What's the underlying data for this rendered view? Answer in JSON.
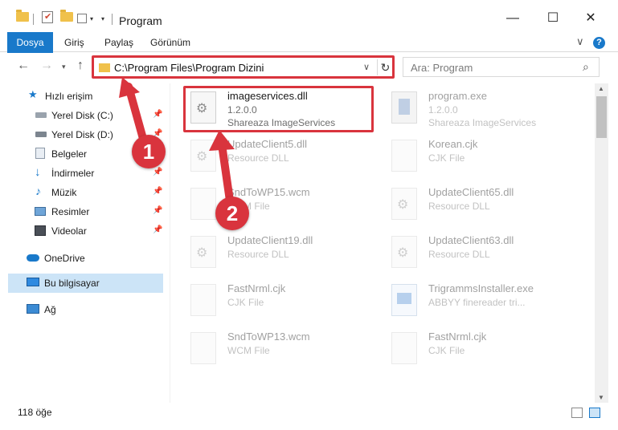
{
  "window": {
    "title": "Program",
    "minimize": "—",
    "maximize": "☐",
    "close": "✕"
  },
  "ribbon": {
    "tabs": [
      "Dosya",
      "Giriş",
      "Paylaş",
      "Görünüm"
    ]
  },
  "address": {
    "path": "C:\\Program Files\\Program Dizini",
    "search_placeholder": "Ara: Program"
  },
  "sidebar": {
    "items": [
      {
        "label": "Hızlı erişim",
        "icon": "star-icon"
      },
      {
        "label": "Yerel Disk (C:)",
        "icon": "drive-icon",
        "pinned": true
      },
      {
        "label": "Yerel Disk (D:)",
        "icon": "drive-icon",
        "pinned": true
      },
      {
        "label": "Belgeler",
        "icon": "documents-icon",
        "pinned": true
      },
      {
        "label": "İndirmeler",
        "icon": "download-icon",
        "pinned": true
      },
      {
        "label": "Müzik",
        "icon": "music-icon",
        "pinned": true
      },
      {
        "label": "Resimler",
        "icon": "pictures-icon",
        "pinned": true
      },
      {
        "label": "Videolar",
        "icon": "video-icon",
        "pinned": true
      },
      {
        "label": "OneDrive",
        "icon": "cloud-icon"
      },
      {
        "label": "Bu bilgisayar",
        "icon": "computer-icon",
        "selected": true
      },
      {
        "label": "Ağ",
        "icon": "network-icon"
      }
    ]
  },
  "files": [
    {
      "name": "imageservices.dll",
      "line2": "1.2.0.0",
      "line3": "Shareaza ImageServices",
      "type": "dll"
    },
    {
      "name": "program.exe",
      "line2": "1.2.0.0",
      "line3": "Shareaza ImageServices",
      "type": "prog"
    },
    {
      "name": "UpdateClient5.dll",
      "line2": "Resource DLL",
      "line3": "",
      "type": "dll"
    },
    {
      "name": "Korean.cjk",
      "line2": "CJK File",
      "line3": "",
      "type": "doc"
    },
    {
      "name": "SndToWP15.wcm",
      "line2": "WCM File",
      "line3": "",
      "type": "doc"
    },
    {
      "name": "UpdateClient65.dll",
      "line2": "Resource DLL",
      "line3": "",
      "type": "dll"
    },
    {
      "name": "UpdateClient19.dll",
      "line2": "Resource DLL",
      "line3": "",
      "type": "dll"
    },
    {
      "name": "UpdateClient63.dll",
      "line2": "Resource DLL",
      "line3": "",
      "type": "dll"
    },
    {
      "name": "FastNrml.cjk",
      "line2": "CJK File",
      "line3": "",
      "type": "doc"
    },
    {
      "name": "TrigrammsInstaller.exe",
      "line2": "ABBYY finereader tri...",
      "line3": "",
      "type": "exe"
    },
    {
      "name": "SndToWP13.wcm",
      "line2": "WCM File",
      "line3": "",
      "type": "doc"
    },
    {
      "name": "FastNrml.cjk",
      "line2": "CJK File",
      "line3": "",
      "type": "doc"
    }
  ],
  "status": {
    "count": "118 öğe"
  },
  "annotations": {
    "marker1": "1",
    "marker2": "2",
    "color": "#d9343d"
  },
  "colors": {
    "accent": "#1979ca",
    "selection": "#cce4f7"
  }
}
